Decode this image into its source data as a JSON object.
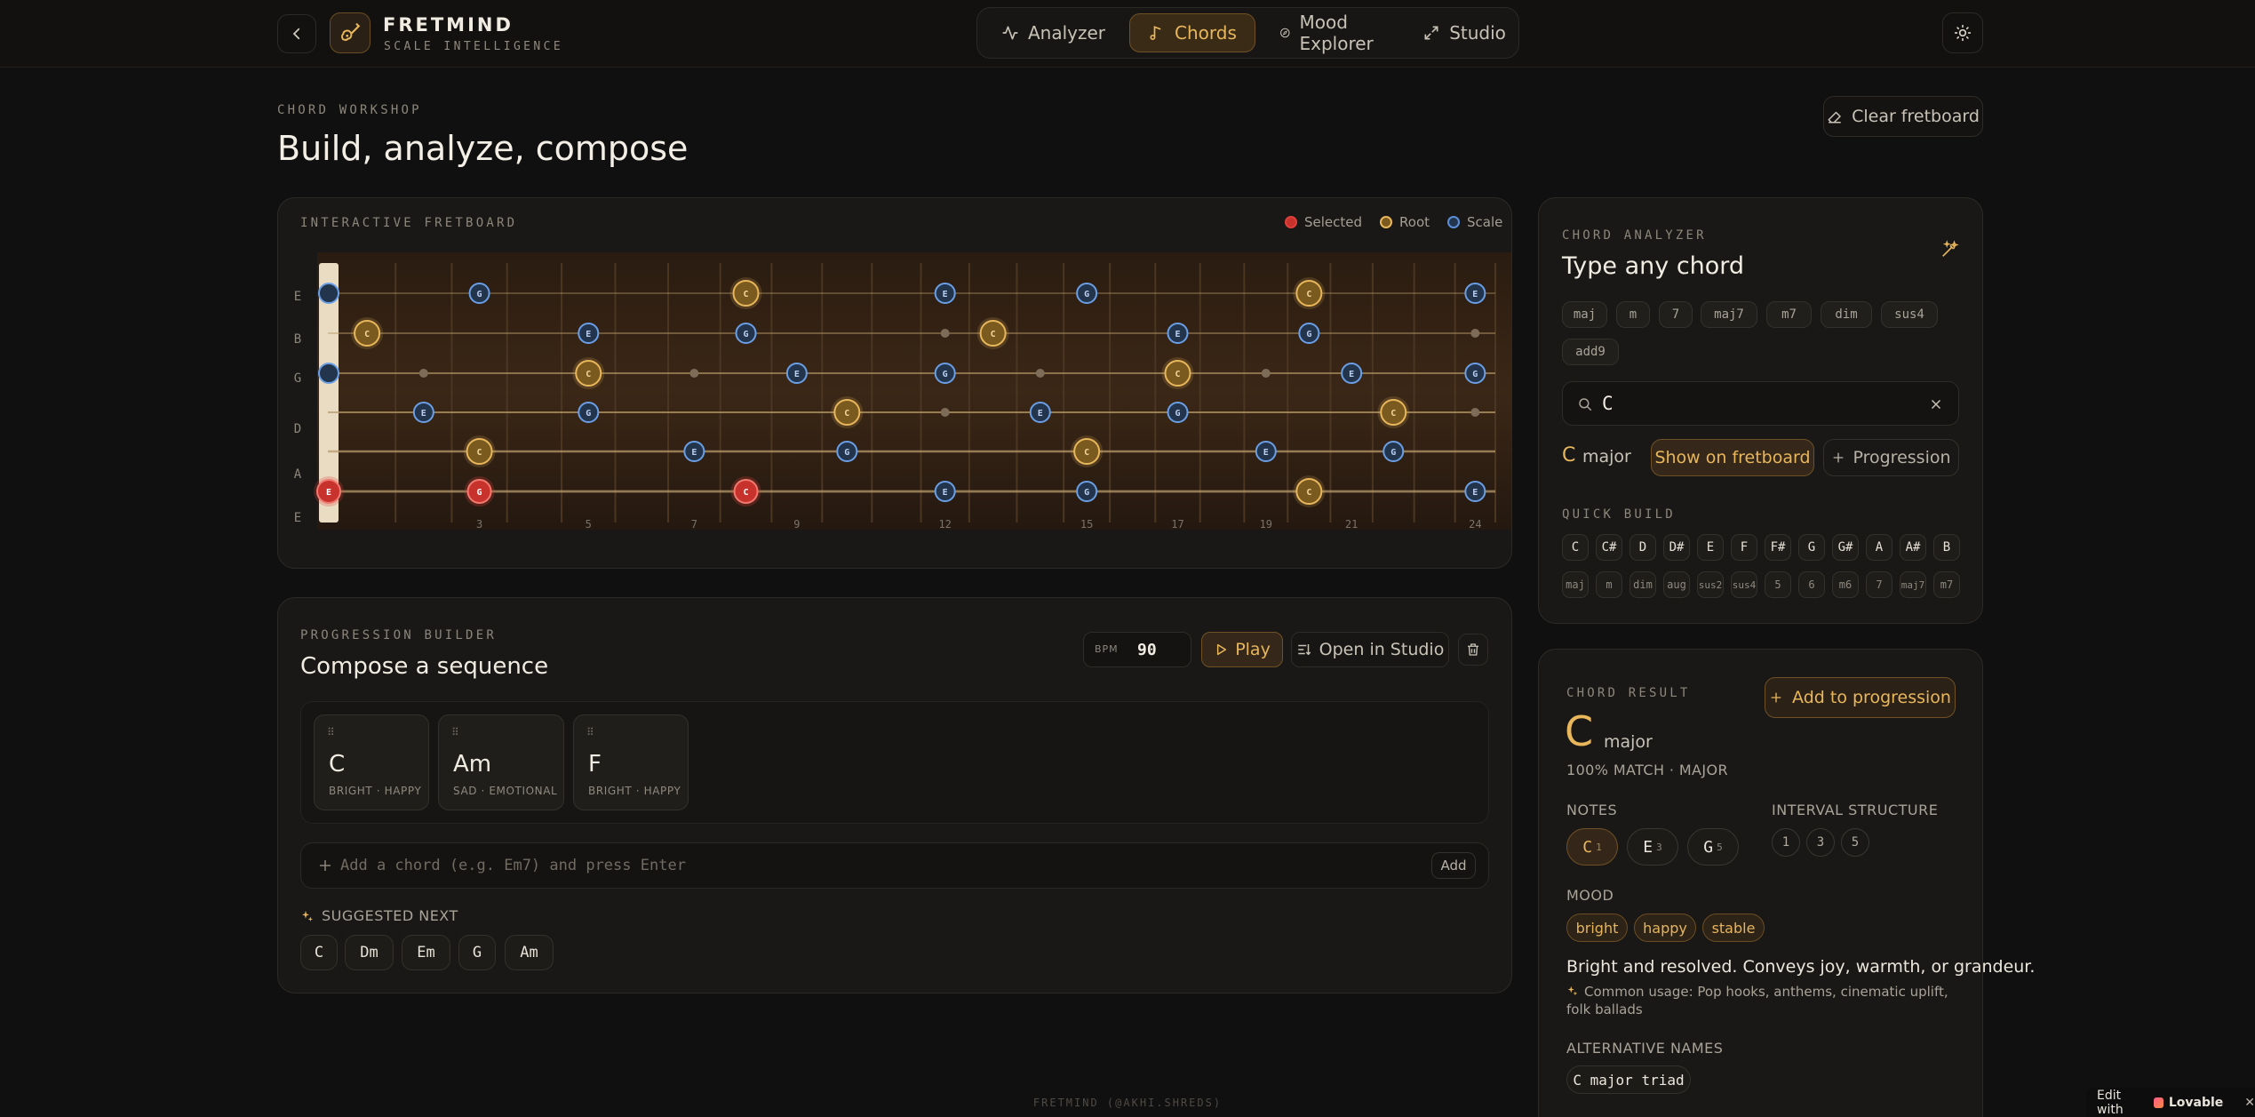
{
  "header": {
    "brand": "FRETMIND",
    "tagline": "SCALE INTELLIGENCE",
    "nav": [
      {
        "label": "Analyzer",
        "active": false
      },
      {
        "label": "Chords",
        "active": true
      },
      {
        "label": "Mood Explorer",
        "active": false
      },
      {
        "label": "Studio",
        "active": false
      }
    ]
  },
  "page": {
    "eyebrow": "CHORD WORKSHOP",
    "title": "Build, analyze, compose",
    "clear_label": "Clear fretboard"
  },
  "fretboard": {
    "eyebrow": "INTERACTIVE FRETBOARD",
    "legend": {
      "selected": "Selected",
      "root": "Root",
      "scale": "Scale"
    },
    "strings": [
      "E",
      "B",
      "G",
      "D",
      "A",
      "E"
    ],
    "fret_numbers": [
      "3",
      "5",
      "7",
      "9",
      "12",
      "15",
      "17",
      "19",
      "21",
      "24"
    ]
  },
  "progression": {
    "eyebrow": "PROGRESSION BUILDER",
    "title": "Compose a sequence",
    "bpm_label": "BPM",
    "bpm_value": "90",
    "play_label": "Play",
    "studio_label": "Open in Studio",
    "chords": [
      {
        "name": "C",
        "mood": "BRIGHT · HAPPY"
      },
      {
        "name": "Am",
        "mood": "SAD · EMOTIONAL"
      },
      {
        "name": "F",
        "mood": "BRIGHT · HAPPY"
      }
    ],
    "input_placeholder": "Add a chord (e.g. Em7) and press Enter",
    "add_label": "Add",
    "suggested_label": "SUGGESTED NEXT",
    "suggested": [
      "C",
      "Dm",
      "Em",
      "G",
      "Am"
    ]
  },
  "analyzer": {
    "eyebrow": "CHORD ANALYZER",
    "title": "Type any chord",
    "qualities": [
      "maj",
      "m",
      "7",
      "maj7",
      "m7",
      "dim",
      "sus4",
      "add9"
    ],
    "search_value": "C",
    "result_root": "C",
    "result_quality": "major",
    "show_label": "Show on fretboard",
    "progression_label": "Progression",
    "quick_build_label": "QUICK BUILD",
    "quick_notes": [
      "C",
      "C#",
      "D",
      "D#",
      "E",
      "F",
      "F#",
      "G",
      "G#",
      "A",
      "A#",
      "B"
    ],
    "quick_qualities": [
      "maj",
      "m",
      "dim",
      "aug",
      "sus2",
      "sus4",
      "5",
      "6",
      "m6",
      "7",
      "maj7",
      "m7"
    ]
  },
  "result": {
    "eyebrow": "CHORD RESULT",
    "add_label": "Add to progression",
    "root": "C",
    "quality": "major",
    "match": "100% MATCH · MAJOR",
    "notes_label": "NOTES",
    "notes": [
      {
        "name": "C",
        "degree": "1"
      },
      {
        "name": "E",
        "degree": "3"
      },
      {
        "name": "G",
        "degree": "5"
      }
    ],
    "interval_label": "INTERVAL STRUCTURE",
    "intervals": [
      "1",
      "3",
      "5"
    ],
    "mood_label": "MOOD",
    "moods": [
      "bright",
      "happy",
      "stable"
    ],
    "description": "Bright and resolved. Conveys joy, warmth, or grandeur.",
    "usage": "Common usage: Pop hooks, anthems, cinematic uplift, folk ballads",
    "alt_label": "ALTERNATIVE NAMES",
    "alt_names": [
      "C major triad"
    ]
  },
  "footer": {
    "text": "FRETMIND (@AKHI.SHREDS)"
  },
  "badge": {
    "edit_with": "Edit with",
    "brand": "Lovable",
    "close": "✕"
  },
  "colors": {
    "accent": "#e8b65b",
    "selected": "#e0403a",
    "scale": "#5a8fd8",
    "background": "#111010"
  }
}
